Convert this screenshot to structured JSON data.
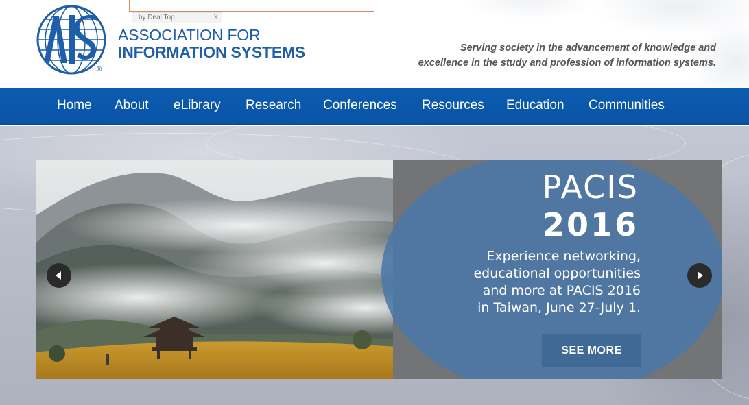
{
  "ad": {
    "label": "by Deal Top",
    "close": "X"
  },
  "logo": {
    "line1": "ASSOCIATION FOR",
    "line2": "INFORMATION SYSTEMS",
    "registered": "®"
  },
  "tagline": {
    "line1": "Serving society in the advancement of knowledge and",
    "line2": "excellence in the study and profession of information systems."
  },
  "nav": {
    "items": [
      {
        "label": "Home"
      },
      {
        "label": "About"
      },
      {
        "label": "eLibrary"
      },
      {
        "label": "Research"
      },
      {
        "label": "Conferences"
      },
      {
        "label": "Resources"
      },
      {
        "label": "Education"
      },
      {
        "label": "Communities"
      }
    ]
  },
  "slide": {
    "title1": "PACIS",
    "title2": "2016",
    "description": {
      "line1": "Experience networking,",
      "line2": "educational opportunities",
      "line3": "and more at PACIS 2016",
      "line4": "in Taiwan, June 27-July 1."
    },
    "button": "SEE MORE"
  },
  "icons": {
    "prev": "arrow-left-icon",
    "next": "arrow-right-icon",
    "logo": "globe-logo-icon"
  },
  "colors": {
    "nav_bg": "#0b5bb0",
    "brand_blue": "#1f5faa",
    "panel_blue": "#4a78a8",
    "button_bg": "#3f6a96"
  }
}
